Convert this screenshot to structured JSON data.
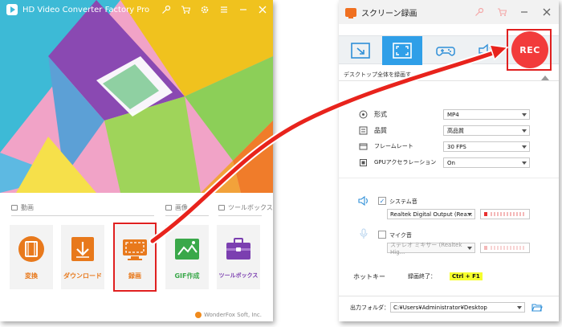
{
  "left_window": {
    "title": "HD Video Converter Factory Pro",
    "titlebar_icons": [
      "key-icon",
      "cart-icon",
      "gear-icon",
      "list-icon",
      "minimize-icon",
      "close-icon"
    ],
    "sections": [
      {
        "label": "動画"
      },
      {
        "label": "画像"
      },
      {
        "label": "ツールボックス"
      }
    ],
    "tools": [
      {
        "label": "変換",
        "icon": "film-reel-icon",
        "color": "#e8791c"
      },
      {
        "label": "ダウンロード",
        "icon": "download-icon",
        "color": "#e8791c"
      },
      {
        "label": "録画",
        "icon": "screen-record-icon",
        "color": "#e8791c"
      },
      {
        "label": "GIF作成",
        "icon": "image-icon",
        "color": "#3aa84a"
      },
      {
        "label": "ツールボックス",
        "icon": "toolbox-icon",
        "color": "#7b3fb0"
      }
    ],
    "brand": "WonderFox Soft, Inc."
  },
  "right_window": {
    "title": "スクリーン録画",
    "titlebar_icons": [
      "key-icon",
      "cart-icon",
      "minimize-icon",
      "close-icon"
    ],
    "modes": [
      {
        "icon": "region-select-icon",
        "active": false
      },
      {
        "icon": "fullscreen-icon",
        "active": true
      },
      {
        "icon": "gamepad-icon",
        "active": false
      },
      {
        "icon": "audio-icon",
        "active": false
      }
    ],
    "rec_label": "REC",
    "description": "デスクトップ全体を録画す...",
    "settings": [
      {
        "label": "形式",
        "icon": "format-icon",
        "value": "MP4"
      },
      {
        "label": "品質",
        "icon": "quality-icon",
        "value": "高品質"
      },
      {
        "label": "フレームレート",
        "icon": "framerate-icon",
        "value": "30 FPS"
      },
      {
        "label": "GPUアクセラレーション",
        "icon": "gpu-icon",
        "value": "On"
      }
    ],
    "audio": {
      "system_label": "システム音",
      "system_checked": true,
      "system_device": "Realtek Digital Output (Rea...",
      "mic_label": "マイク音",
      "mic_checked": false,
      "mic_device": "ステレオ ミキサー (Realtek Hig..."
    },
    "hotkey": {
      "label": "ホットキー",
      "action_label": "録画終了：",
      "key": "Ctrl + F1"
    },
    "output": {
      "label": "出力フォルダ：",
      "path": "C:¥Users¥Administrator¥Desktop"
    }
  },
  "colors": {
    "accent_blue": "#2f9fe8",
    "rec_red": "#f23b3b",
    "highlight_red": "#e02020",
    "hotkey_yellow": "#f6ff2e"
  }
}
